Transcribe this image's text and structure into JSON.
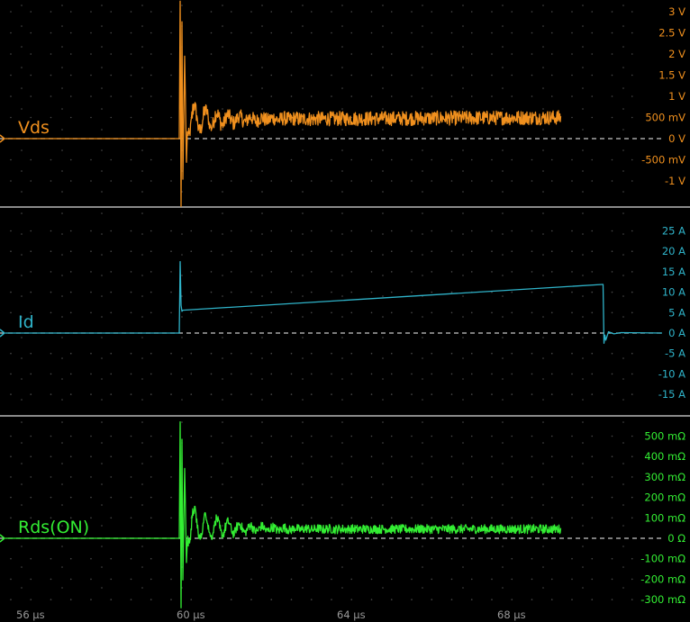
{
  "chart_data": {
    "type": "line",
    "xaxis": {
      "range": [
        55.8,
        72.5
      ],
      "unit": "µs",
      "tick_labels": [
        {
          "x": 56,
          "label": "56 µs"
        },
        {
          "x": 60,
          "label": "60 µs"
        },
        {
          "x": 64,
          "label": "64 µs"
        },
        {
          "x": 68,
          "label": "68 µs"
        }
      ]
    },
    "grid": true,
    "panels": [
      {
        "id": "vds",
        "name": "Vds",
        "color": "#f0901e",
        "ylim": [
          -1.55,
          3.2
        ],
        "ticks": [
          {
            "v": 3,
            "label": "3 V"
          },
          {
            "v": 2.5,
            "label": "2.5 V"
          },
          {
            "v": 2,
            "label": "2 V"
          },
          {
            "v": 1.5,
            "label": "1.5 V"
          },
          {
            "v": 1,
            "label": "1 V"
          },
          {
            "v": 0.5,
            "label": "500 mV"
          },
          {
            "v": 0,
            "label": "0 V"
          },
          {
            "v": -0.5,
            "label": "-500 mV"
          },
          {
            "v": -1,
            "label": "-1 V"
          }
        ],
        "trace": {
          "kind": "ringing",
          "start": 60.0,
          "end": 69.5,
          "baseline_before": 0.0,
          "spike_high": 3.25,
          "spike_low": -1.6,
          "ring_center_start": 0.45,
          "ring_amplitude": 0.55,
          "ring_period": 0.28,
          "ring_decay": 1.3,
          "final_center": 0.45,
          "noise": 0.17,
          "final_offset_rise": 0.05
        }
      },
      {
        "id": "id",
        "name": "Id",
        "color": "#2fb3c9",
        "ylim": [
          -17.5,
          28.5
        ],
        "ticks": [
          {
            "v": 25,
            "label": "25 A"
          },
          {
            "v": 20,
            "label": "20 A"
          },
          {
            "v": 15,
            "label": "15 A"
          },
          {
            "v": 10,
            "label": "10 A"
          },
          {
            "v": 5,
            "label": "5 A"
          },
          {
            "v": 0,
            "label": "0 A"
          },
          {
            "v": -5,
            "label": "-5 A"
          },
          {
            "v": -10,
            "label": "-10 A"
          },
          {
            "v": -15,
            "label": "-15 A"
          }
        ],
        "trace": {
          "kind": "ramp",
          "step_at": 60.0,
          "spike": 17.5,
          "ramp_start": 5.6,
          "ramp_end_x": 70.55,
          "ramp_end": 11.9,
          "undershoot": -2.5
        }
      },
      {
        "id": "rds",
        "name": "Rds(ON)",
        "color": "#33ee33",
        "ylim": [
          -330,
          560
        ],
        "ticks": [
          {
            "v": 500,
            "label": "500 mΩ"
          },
          {
            "v": 400,
            "label": "400 mΩ"
          },
          {
            "v": 300,
            "label": "300 mΩ"
          },
          {
            "v": 200,
            "label": "200 mΩ"
          },
          {
            "v": 100,
            "label": "100 mΩ"
          },
          {
            "v": 0,
            "label": "0 Ω"
          },
          {
            "v": -100,
            "label": "-100 mΩ"
          },
          {
            "v": -200,
            "label": "-200 mΩ"
          },
          {
            "v": -300,
            "label": "-300 mΩ"
          }
        ],
        "trace": {
          "kind": "ringing",
          "start": 60.0,
          "end": 69.5,
          "baseline_before": 0.0,
          "spike_high": 570,
          "spike_low": -340,
          "ring_center_start": 80,
          "ring_amplitude": 120,
          "ring_period": 0.28,
          "ring_decay": 1.1,
          "final_center": 45,
          "noise": 22,
          "final_offset_rise": 0
        }
      }
    ]
  }
}
